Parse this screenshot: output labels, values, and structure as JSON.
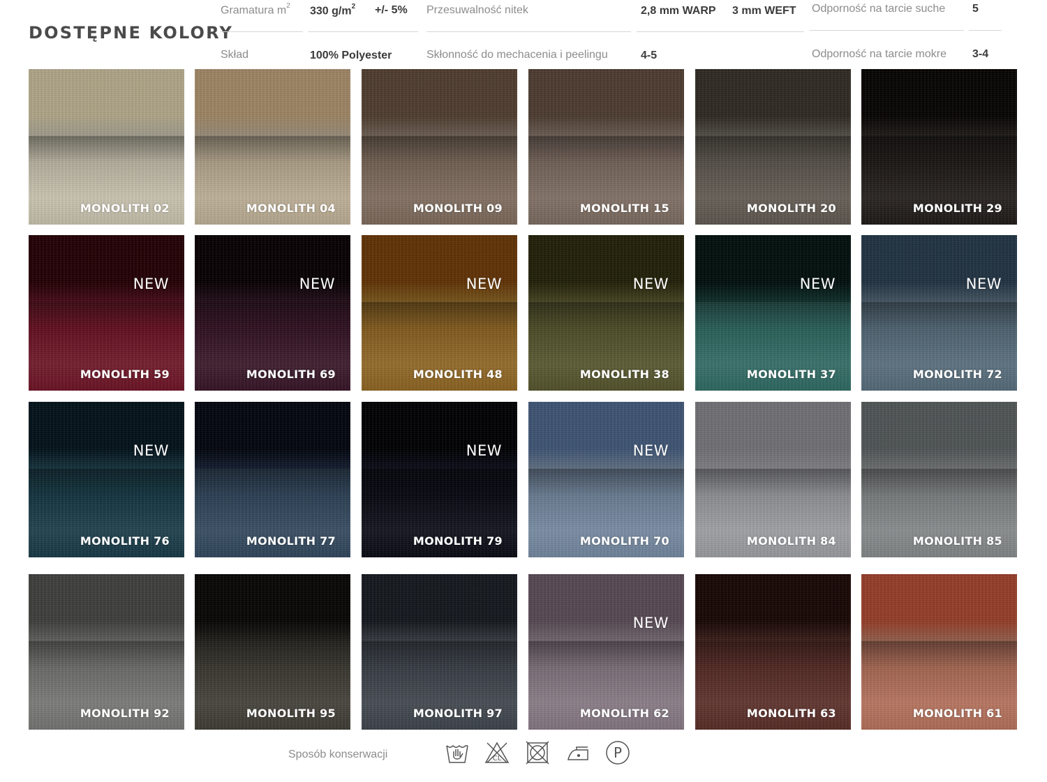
{
  "title": "DOSTĘPNE KOLORY",
  "specs": {
    "gramatura_label": "Gramatura m",
    "gramatura_sup": "2",
    "gramatura_value": "330 g/m",
    "gramatura_value_sup": "2",
    "gramatura_tolerance": "+/- 5%",
    "sklad_label": "Skład",
    "sklad_value": "100% Polyester",
    "przesuwalnosc_label": "Przesuwalność nitek",
    "warp_value": "2,8 mm WARP",
    "weft_value": "3 mm WEFT",
    "mechacenie_label": "Skłonność do mechacenia i peelingu",
    "mechacenie_value": "4-5",
    "tarcie_suche_label": "Odporność na tarcie suche",
    "tarcie_suche_value": "5",
    "tarcie_mokre_label": "Odporność na tarcie mokre",
    "tarcie_mokre_value": "3-4"
  },
  "swatches": [
    {
      "name": "MONOLITH 02",
      "badge": "",
      "top": "#d3cdba",
      "bottom": "#c7c1ad"
    },
    {
      "name": "MONOLITH 04",
      "badge": "",
      "top": "#c8b8a0",
      "bottom": "#bcad94"
    },
    {
      "name": "MONOLITH 09",
      "badge": "",
      "top": "#8e7d6e",
      "bottom": "#7d6a5b"
    },
    {
      "name": "MONOLITH 15",
      "badge": "",
      "top": "#8c7c70",
      "bottom": "#7c6b60"
    },
    {
      "name": "MONOLITH 20",
      "badge": "",
      "top": "#6e685f",
      "bottom": "#5f5850"
    },
    {
      "name": "MONOLITH 29",
      "badge": "",
      "top": "#2b2521",
      "bottom": "#1f1a17"
    },
    {
      "name": "MONOLITH 59",
      "badge": "NEW",
      "top": "#5e0f22",
      "bottom": "#6d1324"
    },
    {
      "name": "MONOLITH 69",
      "badge": "NEW",
      "top": "#2e1220",
      "bottom": "#361426"
    },
    {
      "name": "MONOLITH 48",
      "badge": "NEW",
      "top": "#9d7228",
      "bottom": "#8f6522"
    },
    {
      "name": "MONOLITH 38",
      "badge": "NEW",
      "top": "#5d5b2f",
      "bottom": "#55542c"
    },
    {
      "name": "MONOLITH 37",
      "badge": "NEW",
      "top": "#143f3a",
      "bottom": "#2f6a63"
    },
    {
      "name": "MONOLITH 72",
      "badge": "NEW",
      "top": "#5c7282",
      "bottom": "#566c7b"
    },
    {
      "name": "MONOLITH 76",
      "badge": "NEW",
      "top": "#1d4452",
      "bottom": "#173a47"
    },
    {
      "name": "MONOLITH 77",
      "badge": "",
      "top": "#1b273e",
      "bottom": "#31475d"
    },
    {
      "name": "MONOLITH 79",
      "badge": "NEW",
      "top": "#0f1120",
      "bottom": "#090a14"
    },
    {
      "name": "MONOLITH 70",
      "badge": "NEW",
      "top": "#7f93ac",
      "bottom": "#7488a0"
    },
    {
      "name": "MONOLITH 84",
      "badge": "",
      "top": "#a9a9ad",
      "bottom": "#9c9da2"
    },
    {
      "name": "MONOLITH 85",
      "badge": "",
      "top": "#8f9394",
      "bottom": "#848889"
    },
    {
      "name": "MONOLITH 92",
      "badge": "",
      "top": "#7f7f7d",
      "bottom": "#767674"
    },
    {
      "name": "MONOLITH 95",
      "badge": "",
      "top": "#2d2a24",
      "bottom": "#3f3d35"
    },
    {
      "name": "MONOLITH 97",
      "badge": "",
      "top": "#494f57",
      "bottom": "#3e444c"
    },
    {
      "name": "MONOLITH 62",
      "badge": "NEW",
      "top": "#958892",
      "bottom": "#867883"
    },
    {
      "name": "MONOLITH 63",
      "badge": "",
      "top": "#4f2b24",
      "bottom": "#5a2d27"
    },
    {
      "name": "MONOLITH 61",
      "badge": "",
      "top": "#c27e66",
      "bottom": "#b4705a"
    }
  ],
  "care": {
    "label": "Sposób konserwacji",
    "icons": [
      "hand-wash-icon",
      "no-chlorine-bleach-icon",
      "no-tumble-dry-icon",
      "iron-low-icon",
      "dry-clean-p-icon"
    ],
    "chlorine_text": "CL",
    "dry_clean_letter": "P"
  }
}
